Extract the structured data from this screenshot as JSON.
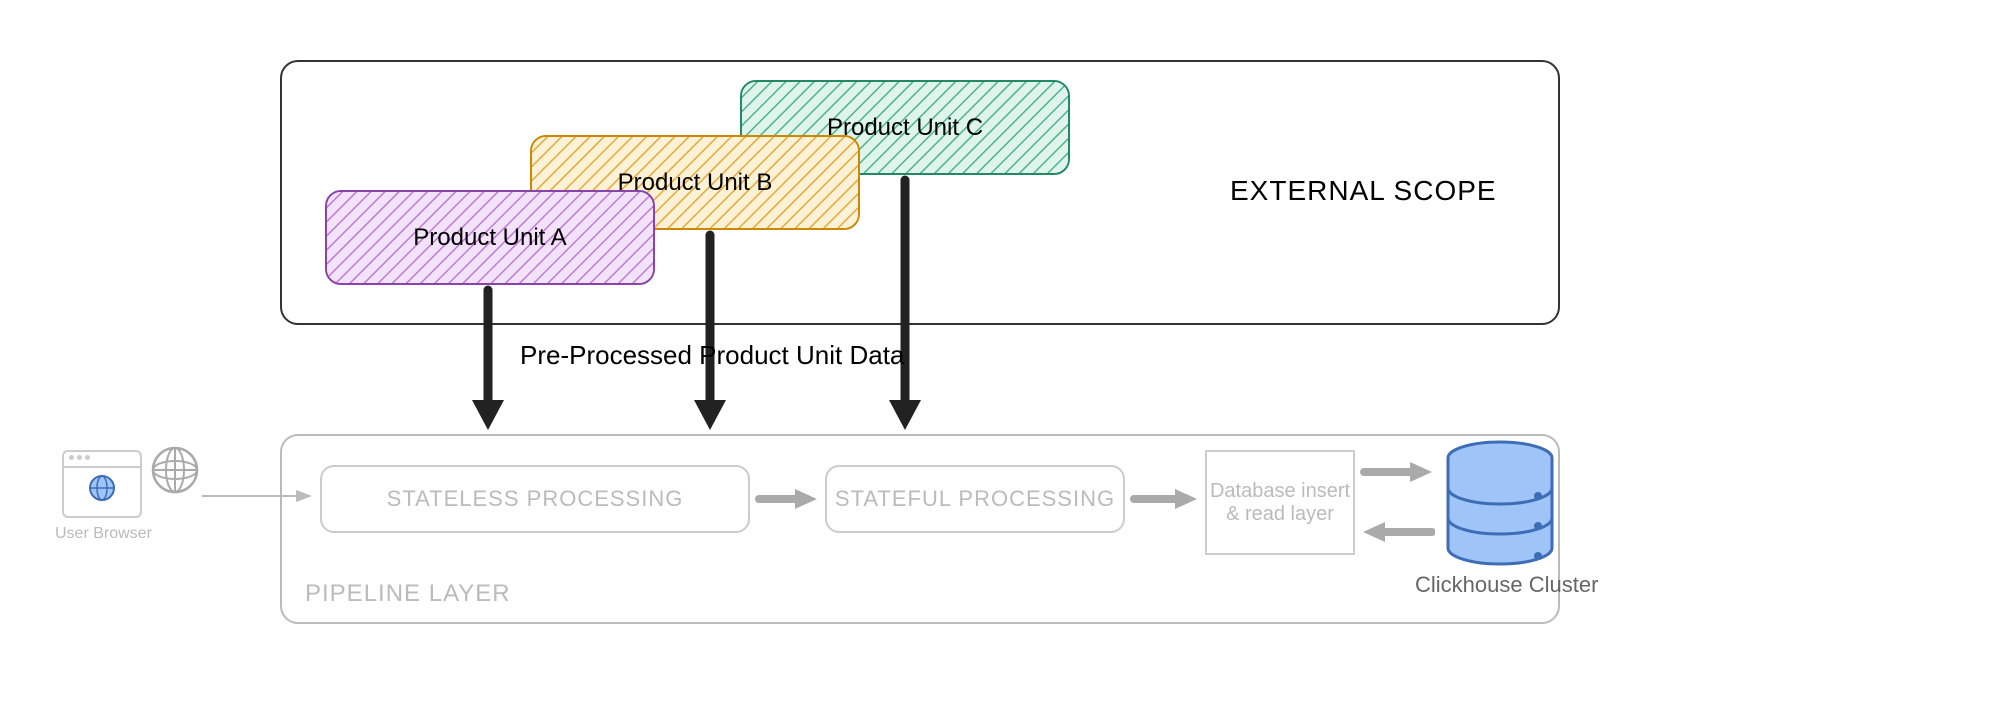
{
  "external_scope": {
    "label": "EXTERNAL SCOPE",
    "units": {
      "a": "Product Unit A",
      "b": "Product Unit B",
      "c": "Product Unit C"
    },
    "preprocessed_label": "Pre-Processed Product Unit Data"
  },
  "pipeline": {
    "label": "PIPELINE LAYER",
    "stateless": "STATELESS PROCESSING",
    "stateful": "STATEFUL PROCESSING",
    "db_layer": "Database insert & read layer"
  },
  "browser": {
    "label": "User Browser"
  },
  "cluster": {
    "label": "Clickhouse Cluster"
  },
  "colors": {
    "unit_a_fill": "#d9a8e8",
    "unit_b_fill": "#f5c95b",
    "unit_c_fill": "#6fcba8",
    "cluster_fill": "#9fc5f8",
    "cluster_stroke": "#3d6db5"
  }
}
